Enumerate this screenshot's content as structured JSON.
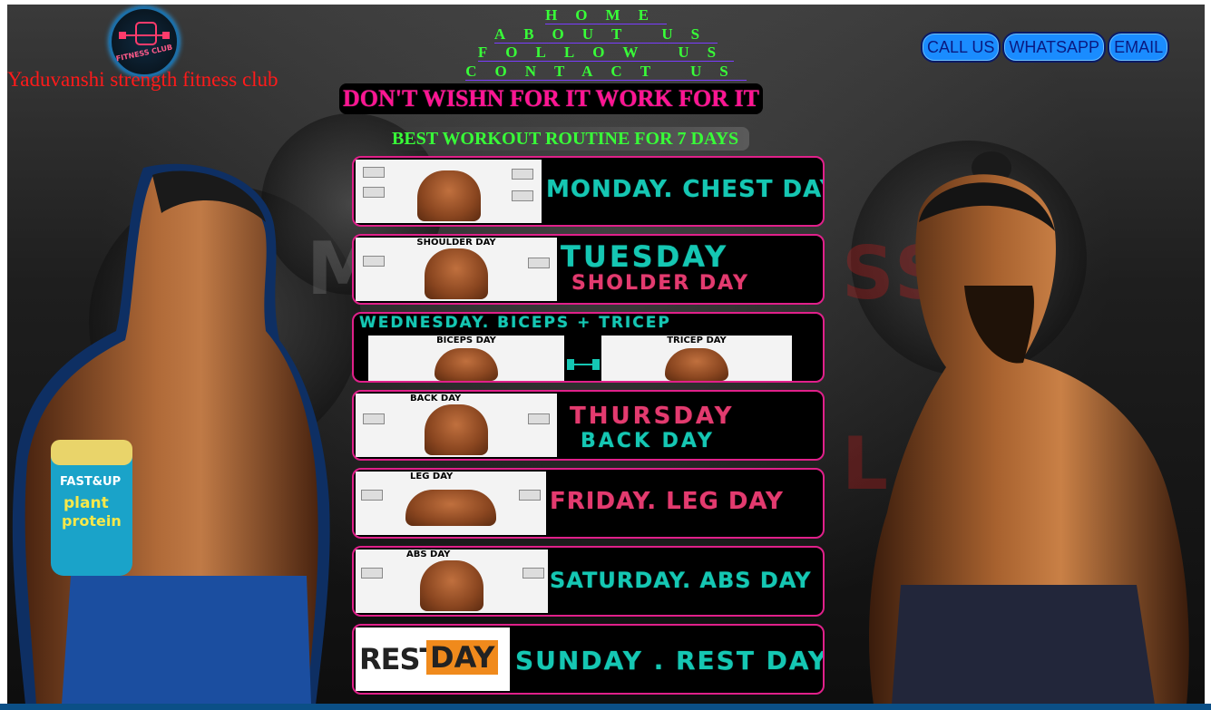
{
  "brand": {
    "logo_text": "FITNESS CLUB",
    "name": "Yaduvanshi strength fitness club"
  },
  "nav": {
    "items": [
      "HOME",
      "ABOUT US",
      "FOLLOW US",
      "CONTACT US"
    ]
  },
  "contact": {
    "buttons": [
      "CALL US",
      "WHATSAPP",
      "EMAIL"
    ]
  },
  "hero": {
    "motto": "DON'T WISHN FOR IT WORK FOR IT",
    "subtitle": "BEST WORKOUT ROUTINE FOR 7 DAYS"
  },
  "routine": [
    {
      "thumb_title": "",
      "line1": "MONDAY. CHEST   DAY",
      "line2": ""
    },
    {
      "thumb_title": "SHOULDER DAY",
      "line1": "TUESDAY",
      "line2": "SHOLDER  DAY"
    },
    {
      "thumb_title": "BICEPS DAY",
      "thumb_title_2": "TRICEP DAY",
      "line1": "WEDNESDAY. BICEPS + TRICEP",
      "line2": ""
    },
    {
      "thumb_title": "BACK DAY",
      "line1": "THURSDAY",
      "line2": "BACK  DAY"
    },
    {
      "thumb_title": "LEG DAY",
      "line1": "FRIDAY. LEG  DAY",
      "line2": ""
    },
    {
      "thumb_title": "ABS DAY",
      "line1": "SATURDAY. ABS   DAY",
      "line2": ""
    },
    {
      "thumb_title": "REST DAY",
      "rest_word_1": "REST",
      "rest_word_2": "DAY",
      "line1": "SUNDAY . REST DAY",
      "line2": ""
    }
  ],
  "product": {
    "label_1": "FAST&UP",
    "label_2": "plant",
    "label_3": "protein"
  },
  "colors": {
    "nav_green": "#38ff38",
    "motto_pink": "#ff1493",
    "card_border": "#e0208a",
    "teal_text": "#15c7b3",
    "pink_text": "#e33b6f",
    "button_blue": "#1a8cff",
    "brand_red": "#ff1a1a"
  }
}
